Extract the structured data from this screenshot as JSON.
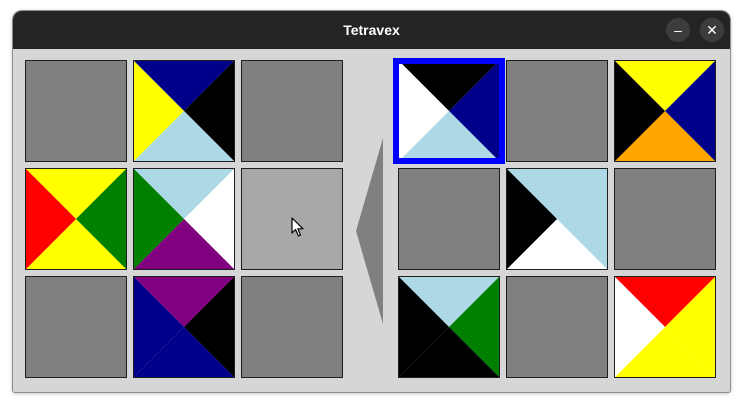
{
  "window": {
    "title": "Tetravex",
    "minimize_label": "–",
    "close_label": "✕"
  },
  "colors": {
    "navy": "#00008b",
    "black": "#000000",
    "yellow": "#ffff00",
    "lightblue": "#add8e6",
    "red": "#ff0000",
    "green": "#008000",
    "white": "#ffffff",
    "purple": "#800080",
    "orange": "#ffa500",
    "empty_slot": "#808080",
    "hover_slot": "#a8a8a8",
    "selection": "#0000ff"
  },
  "board": {
    "left_grid": [
      [
        null,
        {
          "top": "navy",
          "right": "black",
          "bottom": "lightblue",
          "left": "yellow"
        },
        null
      ],
      [
        {
          "top": "yellow",
          "right": "green",
          "bottom": "yellow",
          "left": "red"
        },
        {
          "top": "lightblue",
          "right": "white",
          "bottom": "purple",
          "left": "green"
        },
        "hover"
      ],
      [
        null,
        {
          "top": "purple",
          "right": "black",
          "bottom": "navy",
          "left": "navy"
        },
        null
      ]
    ],
    "right_grid": [
      [
        {
          "top": "black",
          "right": "navy",
          "bottom": "lightblue",
          "left": "white"
        },
        null,
        {
          "top": "yellow",
          "right": "navy",
          "bottom": "orange",
          "left": "black"
        }
      ],
      [
        null,
        {
          "top": "lightblue",
          "right": "lightblue",
          "bottom": "white",
          "left": "black"
        },
        null
      ],
      [
        {
          "top": "lightblue",
          "right": "green",
          "bottom": "black",
          "left": "black"
        },
        null,
        {
          "top": "red",
          "right": "yellow",
          "bottom": "yellow",
          "left": "white"
        }
      ]
    ],
    "selected": {
      "grid": "right",
      "row": 0,
      "col": 0
    }
  },
  "icons": {
    "move_arrow": "left-triangle-icon",
    "pointer": "mouse-cursor-icon"
  }
}
